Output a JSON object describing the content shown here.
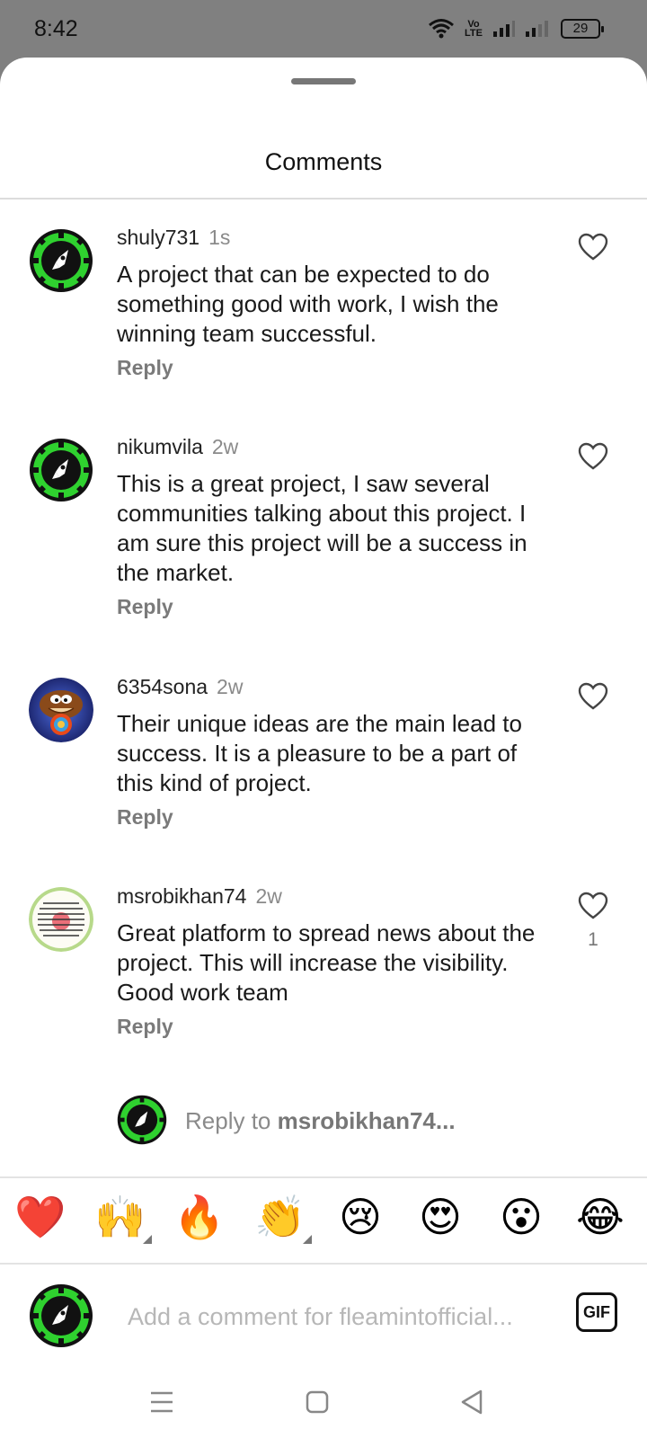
{
  "status_bar": {
    "time": "8:42",
    "network_label": "Vo LTE",
    "battery": "29"
  },
  "sheet": {
    "title": "Comments"
  },
  "comments": [
    {
      "username": "shuly731",
      "time": "1s",
      "text": "A project that can be expected to do something good with work, I wish the winning team successful.",
      "reply_label": "Reply",
      "avatar": "rocket-chip-avatar"
    },
    {
      "username": "nikumvila",
      "time": "2w",
      "text": "This is a great project, I saw several communities talking about this project. I am sure this project will be a success in the market.",
      "reply_label": "Reply",
      "avatar": "rocket-chip-avatar"
    },
    {
      "username": "6354sona",
      "time": "2w",
      "text": "Their unique ideas are the main lead to success. It is a pleasure to be a part of this kind of project.",
      "reply_label": "Reply",
      "avatar": "cartoon-character-avatar"
    },
    {
      "username": "msrobikhan74",
      "time": "2w",
      "text": "Great platform to spread news about the project. This will increase the visibility. Good work team",
      "reply_label": "Reply",
      "like_count": "1",
      "avatar": "bengali-text-avatar"
    }
  ],
  "reply_to": {
    "prefix": "Reply to ",
    "username": "msrobikhan74..."
  },
  "emojis": [
    "❤️",
    "🙌",
    "🔥",
    "👏",
    "😢",
    "😍",
    "😮",
    "😂"
  ],
  "composer": {
    "placeholder": "Add a comment for fleamintofficial...",
    "gif_label": "GIF"
  },
  "colors": {
    "status_bar": "#808080",
    "avatar_green": "#2fd12f",
    "heart_outline": "#444444"
  }
}
